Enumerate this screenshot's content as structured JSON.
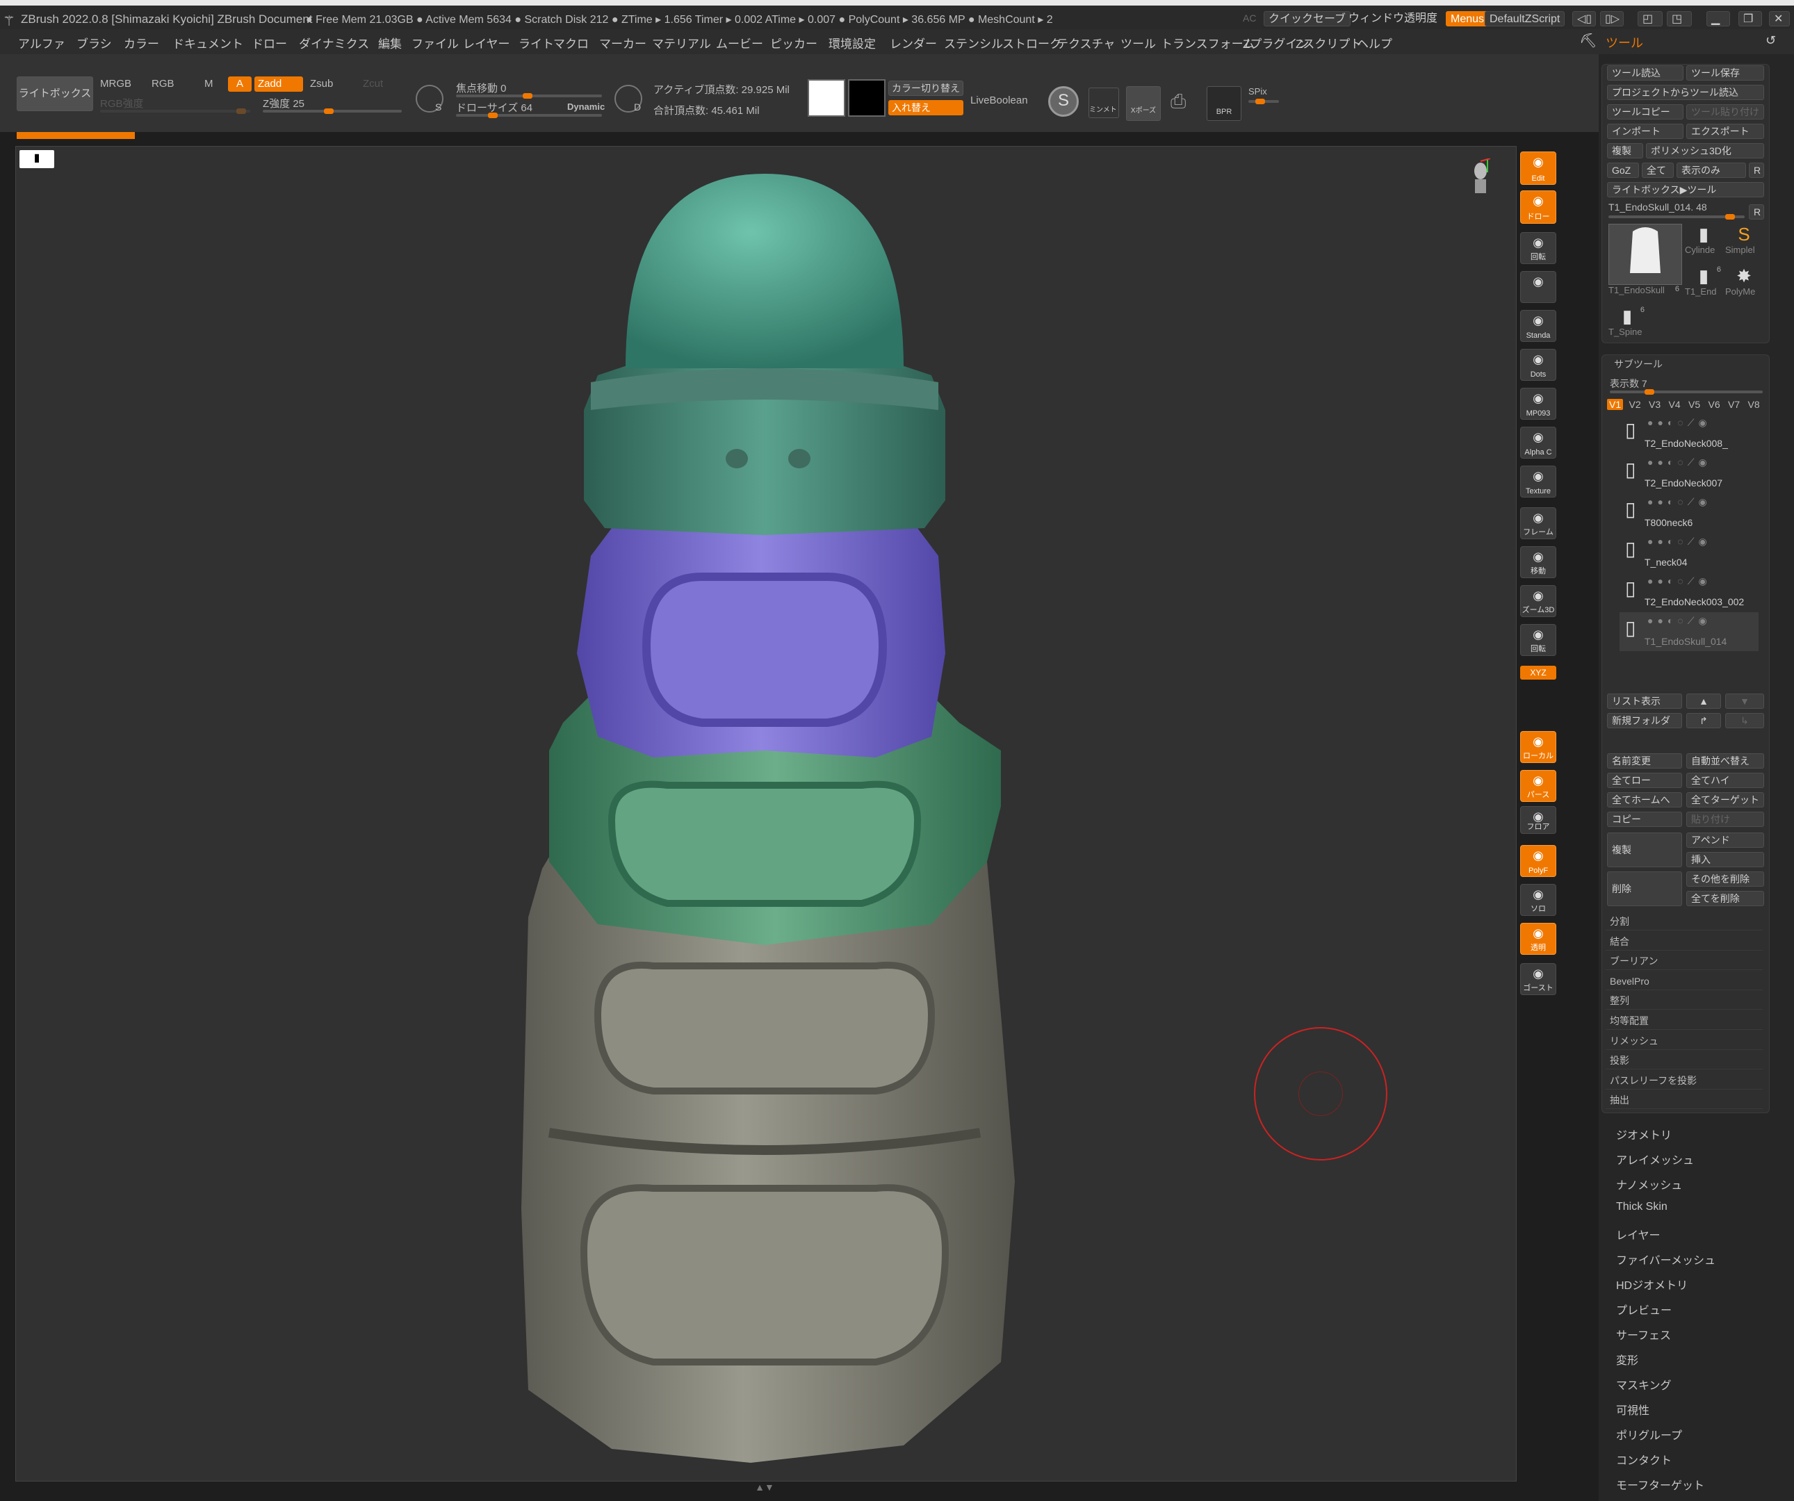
{
  "titlebar": {
    "title": "ZBrush 2022.0.8 [Shimazaki Kyoichi]  ZBrush Document",
    "stats": "● Free Mem 21.03GB ● Active Mem 5634 ● Scratch Disk 212 ● ZTime ▸ 1.656 Timer ▸ 0.002 ATime ▸ 0.007 ● PolyCount ▸ 36.656 MP ● MeshCount ▸ 2",
    "ac": "AC",
    "quicksave": "クイックセーブ",
    "window_transparency": "ウィンドウ透明度",
    "menus": "Menus",
    "script": "DefaultZScript"
  },
  "menu": [
    "アルファ",
    "ブラシ",
    "カラー",
    "ドキュメント",
    "ドロー",
    "ダイナミクス",
    "編集",
    "ファイル",
    "レイヤー",
    "ライト",
    "マクロ",
    "マーカー",
    "マテリアル",
    "ムービー",
    "ピッカー",
    "環境設定",
    "レンダー",
    "ステンシル",
    "ストローク",
    "テクスチャ",
    "ツール",
    "トランスフォーム",
    "Zプラグイン",
    "Zスクリプト",
    "ヘルプ"
  ],
  "menu_right": "ツール",
  "shelf": {
    "lightbox": "ライトボックス",
    "mrgb": "MRGB",
    "rgb": "RGB",
    "m": "M",
    "a": "A",
    "zadd": "Zadd",
    "zsub": "Zsub",
    "zcut": "Zcut",
    "rgb_intensity": "RGB強度",
    "z_intensity": "Z強度 25",
    "focal_shift": "焦点移動 0",
    "draw_size": "ドローサイズ 64",
    "dynamic": "Dynamic",
    "active_points": "アクティブ頂点数: 29.925 Mil",
    "total_points": "合計頂点数: 45.461 Mil",
    "color_switch": "カラー切り替え",
    "swap": "入れ替え",
    "liveboolean": "LiveBoolean",
    "spix": "SPix",
    "symmetry": "ミンメトリ",
    "xpose": "Xポーズ",
    "bpr": "BPR",
    "s_label": "S",
    "d_label": "D"
  },
  "viewport_buttons": [
    {
      "label": "Edit",
      "on": true
    },
    {
      "label": "ドロー",
      "on": true
    },
    {
      "label": "回転",
      "on": false
    },
    {
      "label": "",
      "on": false
    },
    {
      "label": "Standa",
      "on": false
    },
    {
      "label": "Dots",
      "on": false
    },
    {
      "label": "MP093",
      "on": false
    },
    {
      "label": "Alpha C",
      "on": false
    },
    {
      "label": "Texture",
      "on": false
    },
    {
      "label": "フレーム",
      "on": false
    },
    {
      "label": "移動",
      "on": false
    },
    {
      "label": "ズーム3D",
      "on": false
    },
    {
      "label": "回転",
      "on": false
    },
    {
      "label": "ローカル",
      "on": true
    },
    {
      "label": "パース",
      "on": true
    },
    {
      "label": "フロア",
      "on": false
    },
    {
      "label": "PolyF",
      "on": true
    },
    {
      "label": "ソロ",
      "on": false
    },
    {
      "label": "透明",
      "on": true
    },
    {
      "label": "ゴースト",
      "on": false
    }
  ],
  "xyz": "XYZ",
  "tool_panel": {
    "load": "ツール読込",
    "save": "ツール保存",
    "load_from_project": "プロジェクトからツール読込",
    "copy": "ツールコピー",
    "paste": "ツール貼り付け",
    "import": "インポート",
    "export": "エクスポート",
    "clone": "複製",
    "make_polymesh": "ポリメッシュ3D化",
    "goz": "GoZ",
    "all": "全て",
    "visible": "表示のみ",
    "r": "R",
    "lightbox_tools": "ライトボックス▶ツール",
    "current_tool": "T1_EndoSkull_014. 48",
    "thumbs": [
      {
        "name": "T1_EndoSkull",
        "count": "6"
      },
      {
        "name": "Cylinde",
        "count": ""
      },
      {
        "name": "Simplel",
        "count": ""
      },
      {
        "name": "T1_End",
        "count": "6"
      },
      {
        "name": "PolyMe",
        "count": ""
      },
      {
        "name": "T_Spine",
        "count": "6"
      }
    ]
  },
  "subtool": {
    "header": "サブツール",
    "visible_count": "表示数 7",
    "versions": [
      "V1",
      "V2",
      "V3",
      "V4",
      "V5",
      "V6",
      "V7",
      "V8"
    ],
    "items": [
      "T2_EndoNeck008_",
      "T2_EndoNeck007",
      "T800neck6",
      "T_neck04",
      "T2_EndoNeck003_002",
      "T1_EndoSkull_014"
    ],
    "list_view": "リスト表示",
    "new_folder": "新規フォルダ",
    "rename": "名前変更",
    "auto_reorder": "自動並べ替え",
    "all_low": "全てロー",
    "all_high": "全てハイ",
    "all_home": "全てホームへ",
    "all_target": "全てターゲット",
    "copy": "コピー",
    "paste": "貼り付け",
    "duplicate": "複製",
    "append": "アペンド",
    "insert": "挿入",
    "delete": "削除",
    "delete_other": "その他を削除",
    "delete_all": "全てを削除",
    "rows": [
      "分割",
      "結合",
      "ブーリアン",
      "BevelPro",
      "整列",
      "均等配置",
      "リメッシュ",
      "投影",
      "パスレリーフを投影",
      "抽出"
    ]
  },
  "sub_palettes": [
    "ジオメトリ",
    "アレイメッシュ",
    "ナノメッシュ",
    "Thick Skin",
    "レイヤー",
    "ファイバーメッシュ",
    "HDジオメトリ",
    "プレビュー",
    "サーフェス",
    "変形",
    "マスキング",
    "可視性",
    "ポリグループ",
    "コンタクト",
    "モーフターゲット"
  ],
  "colors": {
    "accent": "#f07800",
    "canvas": "#313131",
    "teal": "#3f8f7c",
    "purple": "#7a6fd0",
    "gray": "#8b8a7f"
  }
}
